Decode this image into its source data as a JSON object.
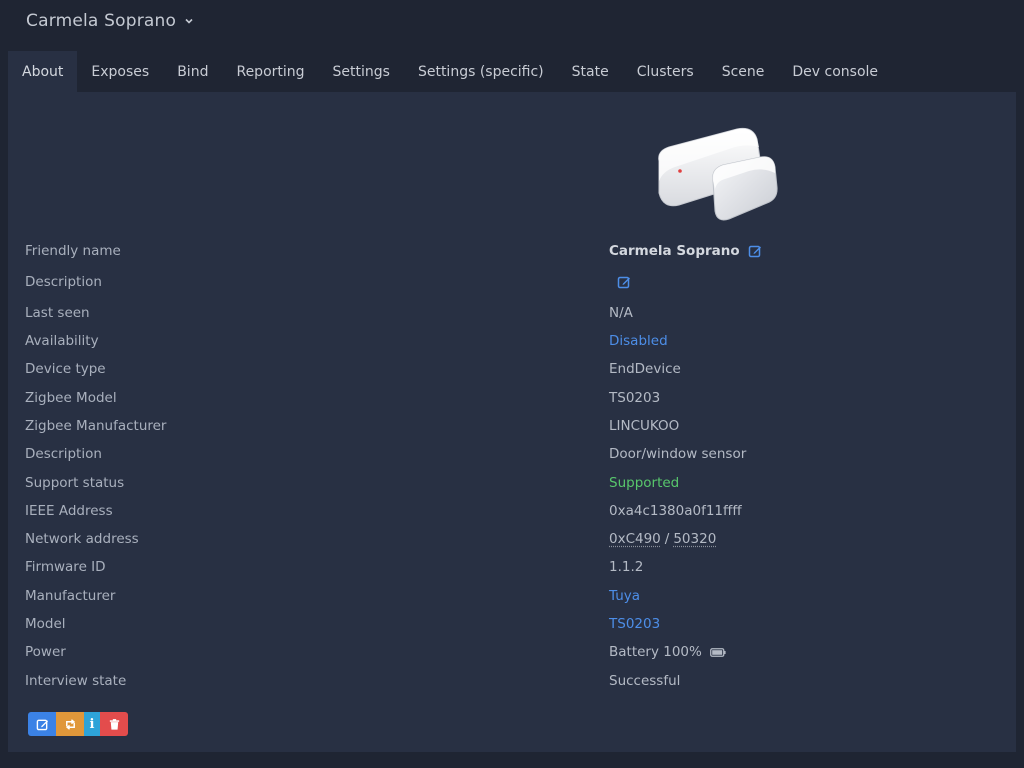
{
  "header": {
    "device_title": "Carmela Soprano"
  },
  "tabs": [
    {
      "label": "About",
      "active": true
    },
    {
      "label": "Exposes"
    },
    {
      "label": "Bind"
    },
    {
      "label": "Reporting"
    },
    {
      "label": "Settings"
    },
    {
      "label": "Settings (specific)"
    },
    {
      "label": "State"
    },
    {
      "label": "Clusters"
    },
    {
      "label": "Scene"
    },
    {
      "label": "Dev console"
    }
  ],
  "about": {
    "friendly_name_label": "Friendly name",
    "friendly_name": "Carmela Soprano",
    "description_label": "Description",
    "description": "",
    "last_seen_label": "Last seen",
    "last_seen": "N/A",
    "availability_label": "Availability",
    "availability": "Disabled",
    "device_type_label": "Device type",
    "device_type": "EndDevice",
    "zigbee_model_label": "Zigbee Model",
    "zigbee_model": "TS0203",
    "zigbee_manufacturer_label": "Zigbee Manufacturer",
    "zigbee_manufacturer": "LINCUKOO",
    "model_description_label": "Description",
    "model_description": "Door/window sensor",
    "support_status_label": "Support status",
    "support_status": "Supported",
    "ieee_label": "IEEE Address",
    "ieee": "0xa4c1380a0f11ffff",
    "network_label": "Network address",
    "network_hex": "0xC490",
    "network_sep": "/",
    "network_dec": "50320",
    "firmware_label": "Firmware ID",
    "firmware": "1.1.2",
    "manufacturer_label": "Manufacturer",
    "manufacturer": "Tuya",
    "model_label": "Model",
    "model": "TS0203",
    "power_label": "Power",
    "power": "Battery 100%",
    "battery_level": 100,
    "interview_label": "Interview state",
    "interview": "Successful"
  },
  "icons": {
    "title_dropdown": "chevron-down-icon",
    "edit": "edit-icon",
    "battery": "battery-full-icon",
    "interview": "retweet-icon",
    "info": "info-icon",
    "delete": "trash-icon"
  },
  "colors": {
    "link": "#4d8ee8",
    "success": "#58c76c",
    "btn_edit": "#3b82e6",
    "btn_interview": "#e0973a",
    "btn_info": "#2ea3d8",
    "btn_delete": "#e34c4c"
  }
}
